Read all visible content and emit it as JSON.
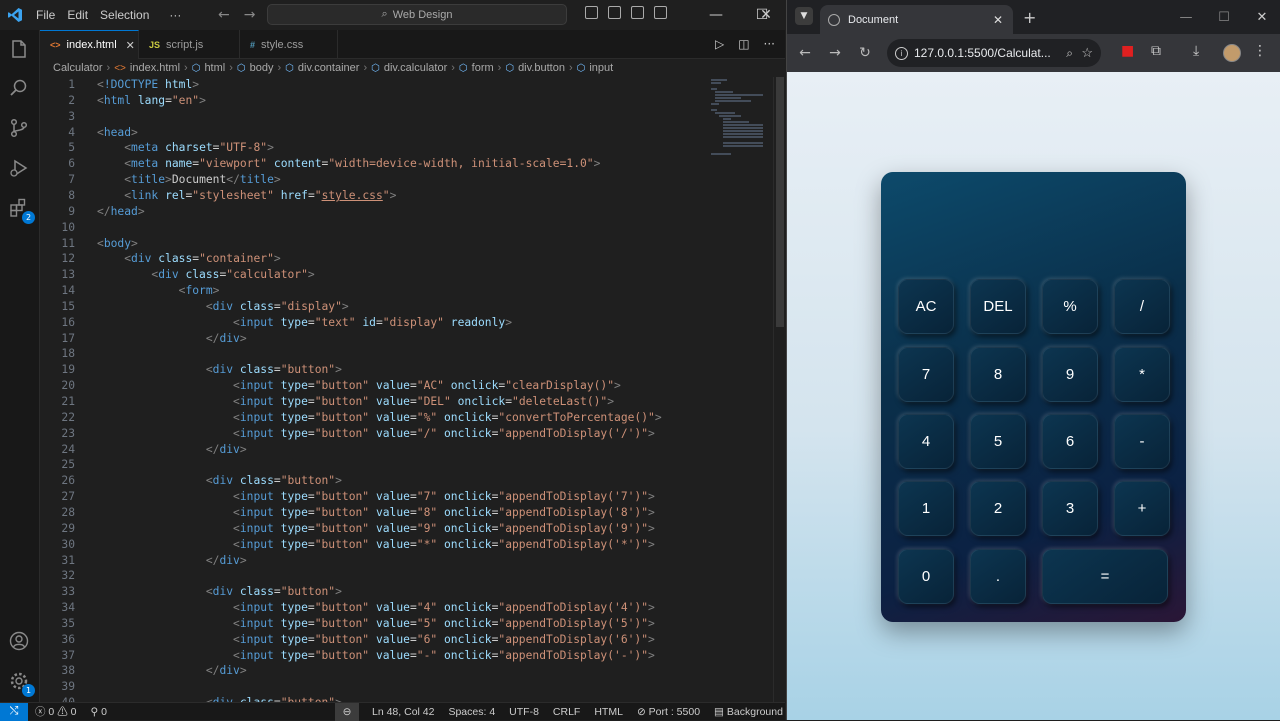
{
  "vscode": {
    "menu": [
      "File",
      "Edit",
      "Selection",
      "···"
    ],
    "command_center": "Web Design",
    "tabs": [
      {
        "icon": "<>",
        "label": "index.html",
        "active": true
      },
      {
        "icon": "JS",
        "label": "script.js",
        "active": false
      },
      {
        "icon": "#",
        "label": "style.css",
        "active": false
      }
    ],
    "breadcrumb": [
      "Calculator",
      "index.html",
      "html",
      "body",
      "div.container",
      "div.calculator",
      "form",
      "div.button",
      "input"
    ],
    "activity_badges": {
      "extensions": "2",
      "manage": "1"
    },
    "status": {
      "errors": "0",
      "warnings": "0",
      "ports": "0",
      "position": "Ln 48, Col 42",
      "spaces": "Spaces: 4",
      "encoding": "UTF-8",
      "eol": "CRLF",
      "language": "HTML",
      "port": "Port : 5500",
      "background": "Background"
    },
    "code_lines": [
      {
        "n": "1",
        "html": "<span class='d'>&lt;</span><span class='t'>!DOCTYPE</span> <span class='a'>html</span><span class='d'>&gt;</span>"
      },
      {
        "n": "2",
        "html": "<span class='d'>&lt;</span><span class='t'>html</span> <span class='a'>lang</span>=<span class='s'>\"en\"</span><span class='d'>&gt;</span>"
      },
      {
        "n": "3",
        "html": ""
      },
      {
        "n": "4",
        "html": "<span class='d'>&lt;</span><span class='t'>head</span><span class='d'>&gt;</span>"
      },
      {
        "n": "5",
        "html": "    <span class='d'>&lt;</span><span class='t'>meta</span> <span class='a'>charset</span>=<span class='s'>\"UTF-8\"</span><span class='d'>&gt;</span>"
      },
      {
        "n": "6",
        "html": "    <span class='d'>&lt;</span><span class='t'>meta</span> <span class='a'>name</span>=<span class='s'>\"viewport\"</span> <span class='a'>content</span>=<span class='s'>\"width=device-width, initial-scale=1.0\"</span><span class='d'>&gt;</span>"
      },
      {
        "n": "7",
        "html": "    <span class='d'>&lt;</span><span class='t'>title</span><span class='d'>&gt;</span>Document<span class='d'>&lt;/</span><span class='t'>title</span><span class='d'>&gt;</span>"
      },
      {
        "n": "8",
        "html": "    <span class='d'>&lt;</span><span class='t'>link</span> <span class='a'>rel</span>=<span class='s'>\"stylesheet\"</span> <span class='a'>href</span>=<span class='s'>\"<span class='u'>style.css</span>\"</span><span class='d'>&gt;</span>"
      },
      {
        "n": "9",
        "html": "<span class='d'>&lt;/</span><span class='t'>head</span><span class='d'>&gt;</span>"
      },
      {
        "n": "10",
        "html": ""
      },
      {
        "n": "11",
        "html": "<span class='d'>&lt;</span><span class='t'>body</span><span class='d'>&gt;</span>"
      },
      {
        "n": "12",
        "html": "    <span class='d'>&lt;</span><span class='t'>div</span> <span class='a'>class</span>=<span class='s'>\"container\"</span><span class='d'>&gt;</span>"
      },
      {
        "n": "13",
        "html": "        <span class='d'>&lt;</span><span class='t'>div</span> <span class='a'>class</span>=<span class='s'>\"calculator\"</span><span class='d'>&gt;</span>"
      },
      {
        "n": "14",
        "html": "            <span class='d'>&lt;</span><span class='t'>form</span><span class='d'>&gt;</span>"
      },
      {
        "n": "15",
        "html": "                <span class='d'>&lt;</span><span class='t'>div</span> <span class='a'>class</span>=<span class='s'>\"display\"</span><span class='d'>&gt;</span>"
      },
      {
        "n": "16",
        "html": "                    <span class='d'>&lt;</span><span class='t'>input</span> <span class='a'>type</span>=<span class='s'>\"text\"</span> <span class='a'>id</span>=<span class='s'>\"display\"</span> <span class='a'>readonly</span><span class='d'>&gt;</span>"
      },
      {
        "n": "17",
        "html": "                <span class='d'>&lt;/</span><span class='t'>div</span><span class='d'>&gt;</span>"
      },
      {
        "n": "18",
        "html": ""
      },
      {
        "n": "19",
        "html": "                <span class='d'>&lt;</span><span class='t'>div</span> <span class='a'>class</span>=<span class='s'>\"button\"</span><span class='d'>&gt;</span>"
      },
      {
        "n": "20",
        "html": "                    <span class='d'>&lt;</span><span class='t'>input</span> <span class='a'>type</span>=<span class='s'>\"button\"</span> <span class='a'>value</span>=<span class='s'>\"AC\"</span> <span class='a'>onclick</span>=<span class='s'>\"clearDisplay()\"</span><span class='d'>&gt;</span>"
      },
      {
        "n": "21",
        "html": "                    <span class='d'>&lt;</span><span class='t'>input</span> <span class='a'>type</span>=<span class='s'>\"button\"</span> <span class='a'>value</span>=<span class='s'>\"DEL\"</span> <span class='a'>onclick</span>=<span class='s'>\"deleteLast()\"</span><span class='d'>&gt;</span>"
      },
      {
        "n": "22",
        "html": "                    <span class='d'>&lt;</span><span class='t'>input</span> <span class='a'>type</span>=<span class='s'>\"button\"</span> <span class='a'>value</span>=<span class='s'>\"%\"</span> <span class='a'>onclick</span>=<span class='s'>\"convertToPercentage()\"</span><span class='d'>&gt;</span>"
      },
      {
        "n": "23",
        "html": "                    <span class='d'>&lt;</span><span class='t'>input</span> <span class='a'>type</span>=<span class='s'>\"button\"</span> <span class='a'>value</span>=<span class='s'>\"/\"</span> <span class='a'>onclick</span>=<span class='s'>\"appendToDisplay('/')\"</span><span class='d'>&gt;</span>"
      },
      {
        "n": "24",
        "html": "                <span class='d'>&lt;/</span><span class='t'>div</span><span class='d'>&gt;</span>"
      },
      {
        "n": "25",
        "html": ""
      },
      {
        "n": "26",
        "html": "                <span class='d'>&lt;</span><span class='t'>div</span> <span class='a'>class</span>=<span class='s'>\"button\"</span><span class='d'>&gt;</span>"
      },
      {
        "n": "27",
        "html": "                    <span class='d'>&lt;</span><span class='t'>input</span> <span class='a'>type</span>=<span class='s'>\"button\"</span> <span class='a'>value</span>=<span class='s'>\"7\"</span> <span class='a'>onclick</span>=<span class='s'>\"appendToDisplay('7')\"</span><span class='d'>&gt;</span>"
      },
      {
        "n": "28",
        "html": "                    <span class='d'>&lt;</span><span class='t'>input</span> <span class='a'>type</span>=<span class='s'>\"button\"</span> <span class='a'>value</span>=<span class='s'>\"8\"</span> <span class='a'>onclick</span>=<span class='s'>\"appendToDisplay('8')\"</span><span class='d'>&gt;</span>"
      },
      {
        "n": "29",
        "html": "                    <span class='d'>&lt;</span><span class='t'>input</span> <span class='a'>type</span>=<span class='s'>\"button\"</span> <span class='a'>value</span>=<span class='s'>\"9\"</span> <span class='a'>onclick</span>=<span class='s'>\"appendToDisplay('9')\"</span><span class='d'>&gt;</span>"
      },
      {
        "n": "30",
        "html": "                    <span class='d'>&lt;</span><span class='t'>input</span> <span class='a'>type</span>=<span class='s'>\"button\"</span> <span class='a'>value</span>=<span class='s'>\"*\"</span> <span class='a'>onclick</span>=<span class='s'>\"appendToDisplay('*')\"</span><span class='d'>&gt;</span>"
      },
      {
        "n": "31",
        "html": "                <span class='d'>&lt;/</span><span class='t'>div</span><span class='d'>&gt;</span>"
      },
      {
        "n": "32",
        "html": ""
      },
      {
        "n": "33",
        "html": "                <span class='d'>&lt;</span><span class='t'>div</span> <span class='a'>class</span>=<span class='s'>\"button\"</span><span class='d'>&gt;</span>"
      },
      {
        "n": "34",
        "html": "                    <span class='d'>&lt;</span><span class='t'>input</span> <span class='a'>type</span>=<span class='s'>\"button\"</span> <span class='a'>value</span>=<span class='s'>\"4\"</span> <span class='a'>onclick</span>=<span class='s'>\"appendToDisplay('4')\"</span><span class='d'>&gt;</span>"
      },
      {
        "n": "35",
        "html": "                    <span class='d'>&lt;</span><span class='t'>input</span> <span class='a'>type</span>=<span class='s'>\"button\"</span> <span class='a'>value</span>=<span class='s'>\"5\"</span> <span class='a'>onclick</span>=<span class='s'>\"appendToDisplay('5')\"</span><span class='d'>&gt;</span>"
      },
      {
        "n": "36",
        "html": "                    <span class='d'>&lt;</span><span class='t'>input</span> <span class='a'>type</span>=<span class='s'>\"button\"</span> <span class='a'>value</span>=<span class='s'>\"6\"</span> <span class='a'>onclick</span>=<span class='s'>\"appendToDisplay('6')\"</span><span class='d'>&gt;</span>"
      },
      {
        "n": "37",
        "html": "                    <span class='d'>&lt;</span><span class='t'>input</span> <span class='a'>type</span>=<span class='s'>\"button\"</span> <span class='a'>value</span>=<span class='s'>\"-\"</span> <span class='a'>onclick</span>=<span class='s'>\"appendToDisplay('-')\"</span><span class='d'>&gt;</span>"
      },
      {
        "n": "38",
        "html": "                <span class='d'>&lt;/</span><span class='t'>div</span><span class='d'>&gt;</span>"
      },
      {
        "n": "39",
        "html": ""
      },
      {
        "n": "40",
        "html": "                <span class='d'>&lt;</span><span class='t'>div</span> <span class='a'>class</span>=<span class='s'>\"button\"</span><span class='d'>&gt;</span>"
      }
    ]
  },
  "chrome": {
    "tab_title": "Document",
    "url": "127.0.0.1:5500/Calculat...",
    "calculator": {
      "buttons": [
        "AC",
        "DEL",
        "%",
        "/",
        "7",
        "8",
        "9",
        "*",
        "4",
        "5",
        "6",
        "-",
        "1",
        "2",
        "3",
        "+",
        "0",
        ".",
        "="
      ]
    }
  }
}
